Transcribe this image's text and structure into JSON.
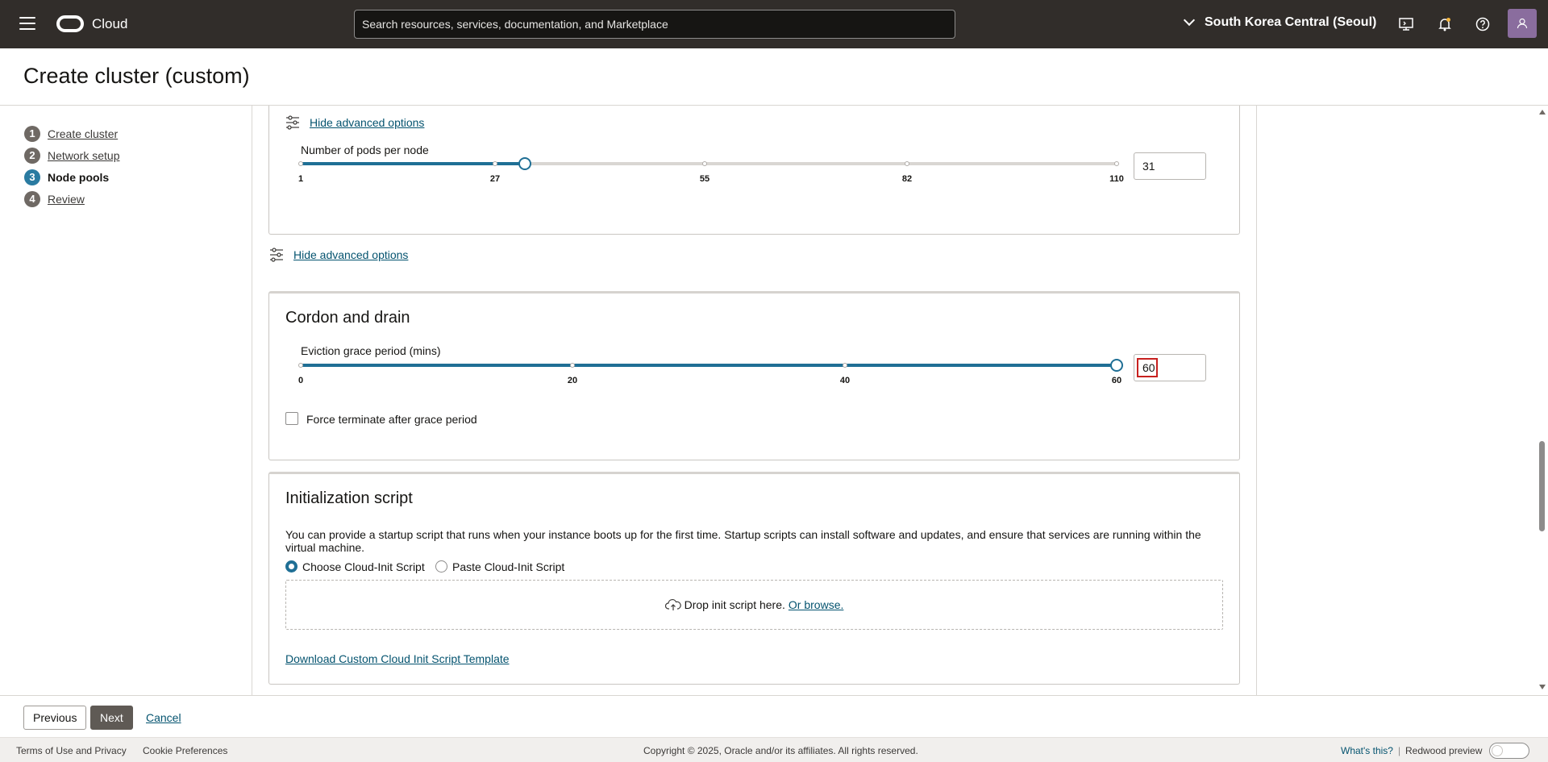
{
  "header": {
    "brand": "Cloud",
    "search_placeholder": "Search resources, services, documentation, and Marketplace",
    "region": "South Korea Central (Seoul)"
  },
  "page": {
    "title": "Create cluster (custom)"
  },
  "steps": [
    {
      "num": "1",
      "label": "Create cluster"
    },
    {
      "num": "2",
      "label": "Network setup"
    },
    {
      "num": "3",
      "label": "Node pools"
    },
    {
      "num": "4",
      "label": "Review"
    }
  ],
  "pods_panel": {
    "advanced_link": "Hide advanced options",
    "label": "Number of pods per node",
    "ticks": [
      "1",
      "27",
      "55",
      "82",
      "110"
    ],
    "value": "31"
  },
  "advanced_link_2": "Hide advanced options",
  "cordon": {
    "title": "Cordon and drain",
    "label": "Eviction grace period (mins)",
    "ticks": [
      "0",
      "20",
      "40",
      "60"
    ],
    "value": "60",
    "checkbox_label": "Force terminate after grace period"
  },
  "init": {
    "title": "Initialization script",
    "description": "You can provide a startup script that runs when your instance boots up for the first time. Startup scripts can install software and updates, and ensure that services are running within the virtual machine.",
    "radio_choose": "Choose Cloud-Init Script",
    "radio_paste": "Paste Cloud-Init Script",
    "drop_text": "Drop init script here.",
    "browse_link": "Or browse.",
    "download_link": "Download Custom Cloud Init Script Template"
  },
  "actions": {
    "previous": "Previous",
    "next": "Next",
    "cancel": "Cancel"
  },
  "footer": {
    "terms": "Terms of Use and Privacy",
    "cookies": "Cookie Preferences",
    "copyright": "Copyright © 2025, Oracle and/or its affiliates. All rights reserved.",
    "whats_this": "What's this?",
    "redwood": "Redwood preview"
  },
  "colors": {
    "accent": "#1f6f95",
    "header_bg": "#312d2a",
    "link": "#04536f",
    "highlight": "#c7211f"
  }
}
